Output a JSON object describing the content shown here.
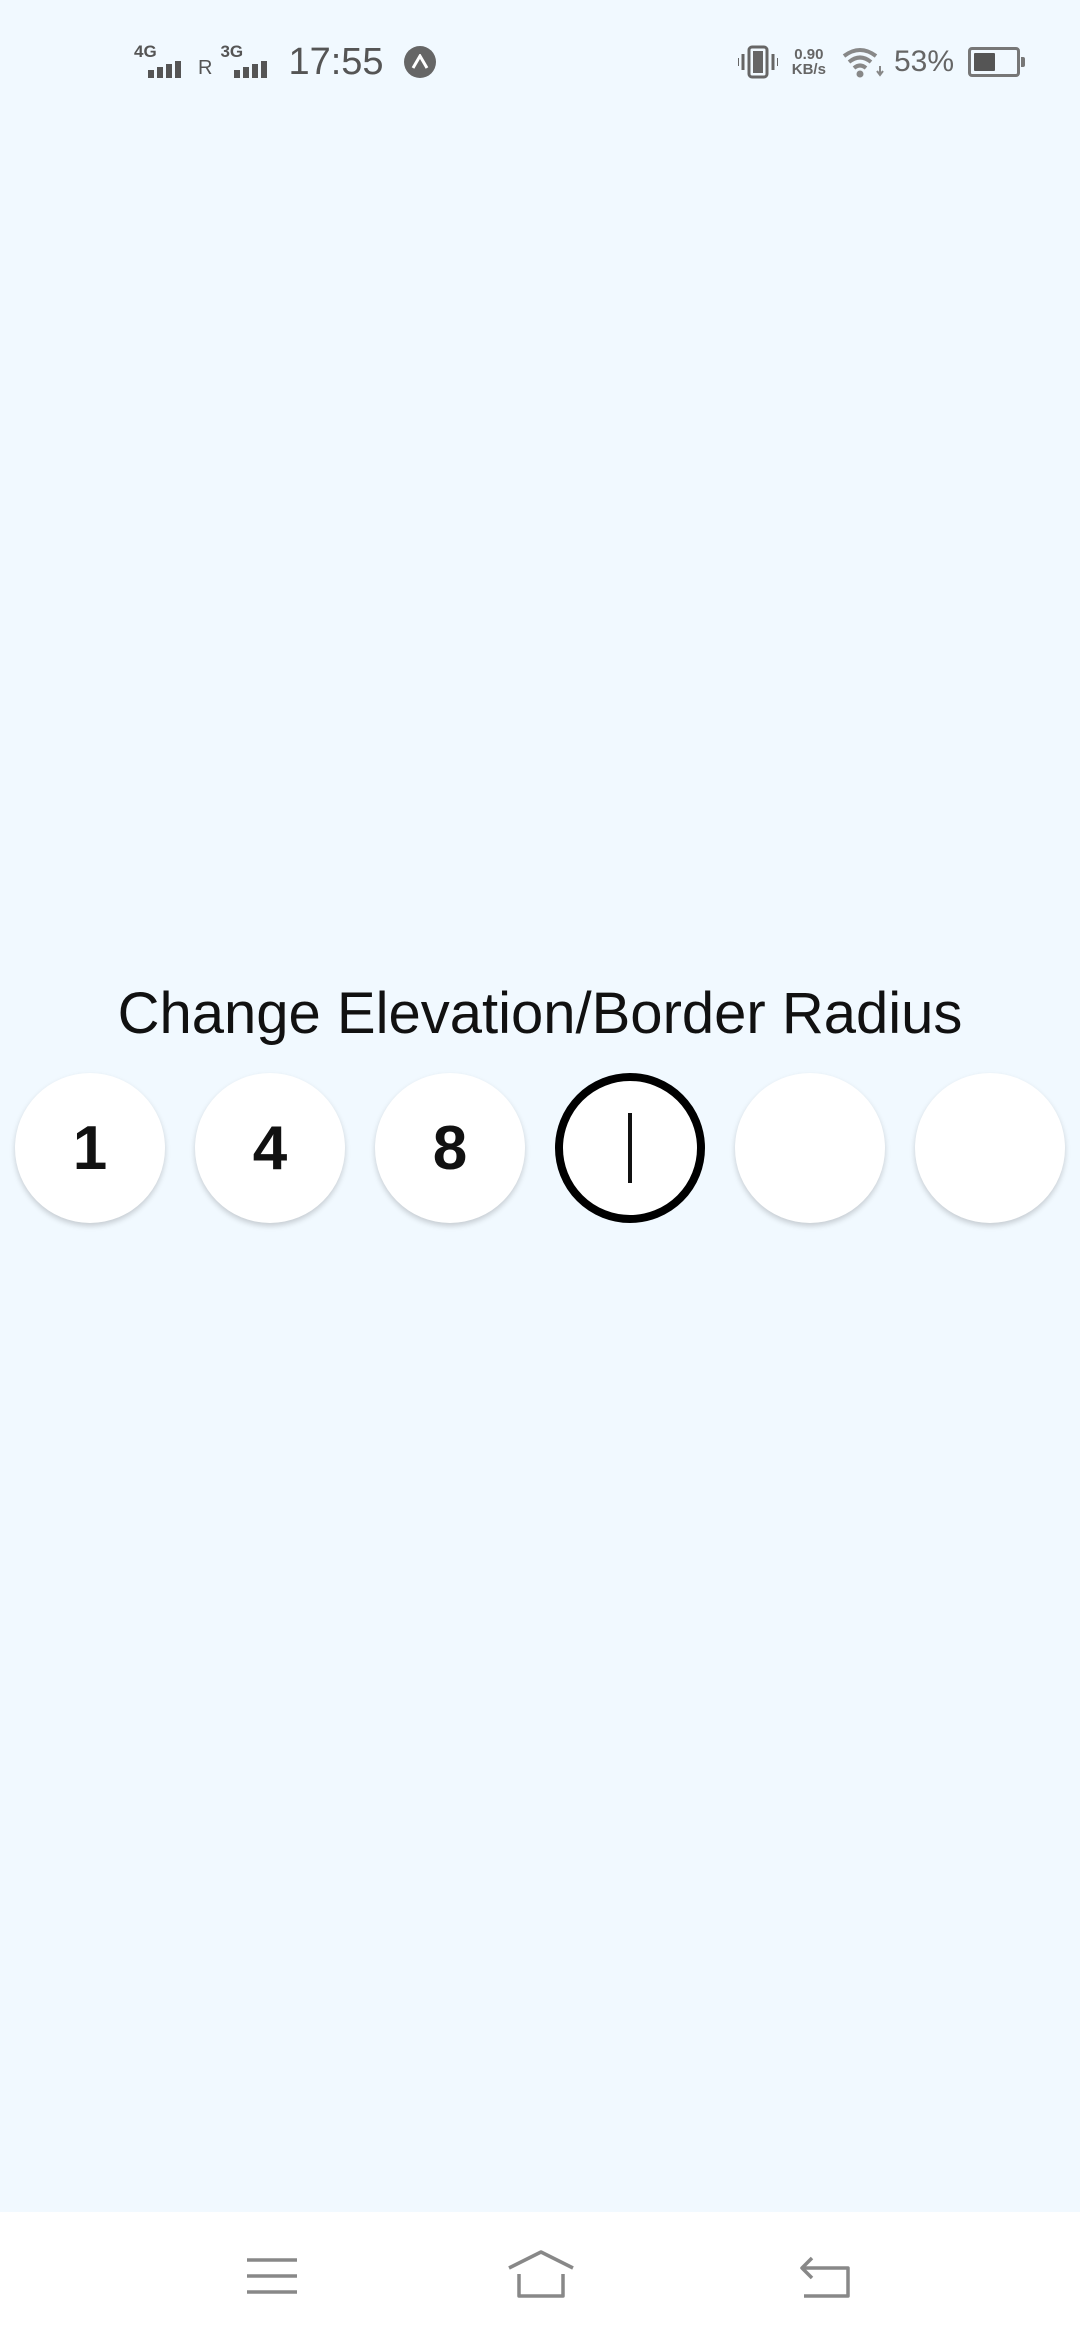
{
  "status_bar": {
    "network1": "4G",
    "roaming": "R",
    "network2": "3G",
    "time": "17:55",
    "speed_value": "0.90",
    "speed_unit": "KB/s",
    "battery": "53%",
    "battery_level": 0.53
  },
  "main": {
    "title": "Change Elevation/Border Radius",
    "circles": [
      {
        "label": "1"
      },
      {
        "label": "4"
      },
      {
        "label": "8"
      },
      {
        "label": ""
      },
      {
        "label": ""
      },
      {
        "label": ""
      }
    ]
  },
  "icons": {
    "alert": "a-icon",
    "vibrate": "vibrate-icon",
    "wifi": "wifi-icon",
    "battery": "battery-icon",
    "menu": "menu-icon",
    "home": "home-icon",
    "back": "back-icon"
  },
  "colors": {
    "background": "#f1f9ff",
    "circle": "#ffffff",
    "active_border": "#000000"
  }
}
